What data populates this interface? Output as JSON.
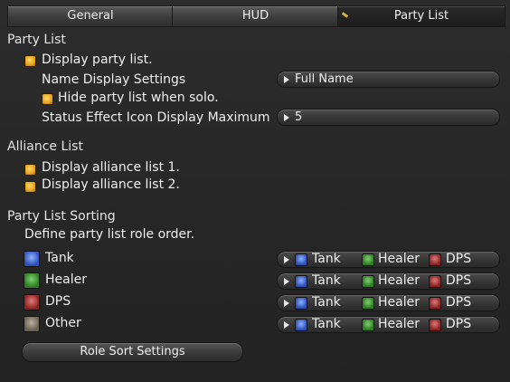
{
  "tabs": [
    {
      "label": "General"
    },
    {
      "label": "HUD"
    },
    {
      "label": "Party List"
    }
  ],
  "party_list": {
    "heading": "Party List",
    "display_label": "Display party list.",
    "display_checked": true,
    "name_display_label": "Name Display Settings",
    "name_display_value": "Full Name",
    "hide_solo_label": "Hide party list when solo.",
    "hide_solo_checked": true,
    "status_icon_label": "Status Effect Icon Display Maximum",
    "status_icon_value": "5"
  },
  "alliance_list": {
    "heading": "Alliance List",
    "items": [
      {
        "label": "Display alliance list 1.",
        "checked": true
      },
      {
        "label": "Display alliance list 2.",
        "checked": true
      }
    ]
  },
  "sorting": {
    "heading": "Party List Sorting",
    "description": "Define party list role order.",
    "rows": [
      {
        "role": "Tank",
        "icon": "tank-icon",
        "order": [
          "Tank",
          "Healer",
          "DPS"
        ]
      },
      {
        "role": "Healer",
        "icon": "healer-icon",
        "order": [
          "Tank",
          "Healer",
          "DPS"
        ]
      },
      {
        "role": "DPS",
        "icon": "dps-icon",
        "order": [
          "Tank",
          "Healer",
          "DPS"
        ]
      },
      {
        "role": "Other",
        "icon": "other-icon",
        "order": [
          "Tank",
          "Healer",
          "DPS"
        ]
      }
    ],
    "role_sort_button": "Role Sort Settings"
  },
  "colors": {
    "checkbox": "#e6a21c",
    "tank": "#2d4fb8",
    "healer": "#2f7a25",
    "dps": "#8b2222"
  }
}
